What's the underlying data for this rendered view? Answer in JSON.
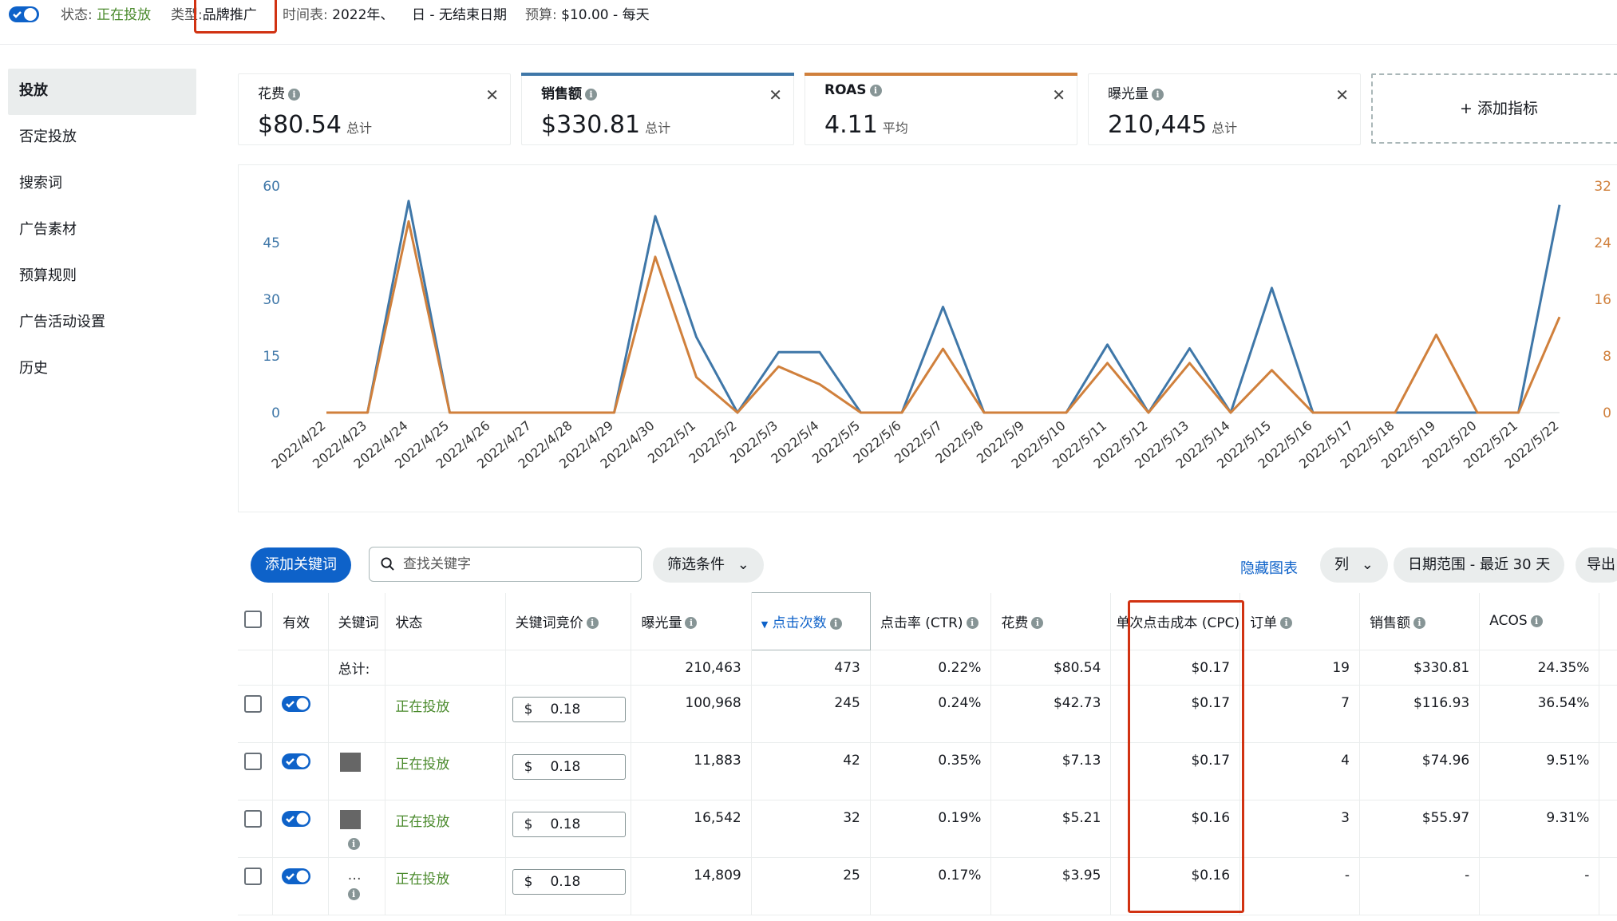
{
  "topbar": {
    "status_label": "状态:",
    "status_value": "正在投放",
    "type_label": "类型:",
    "type_value": "品牌推广",
    "schedule_label": "时间表:",
    "schedule_start": "2022年、",
    "schedule_end": "日 - 无结束日期",
    "budget_label": "预算:",
    "budget_value": "$10.00 - 每天"
  },
  "sidebar": {
    "items": [
      {
        "label": "投放",
        "active": true
      },
      {
        "label": "否定投放"
      },
      {
        "label": "搜索词"
      },
      {
        "label": "广告素材"
      },
      {
        "label": "预算规则"
      },
      {
        "label": "广告活动设置"
      },
      {
        "label": "历史"
      }
    ]
  },
  "metrics": [
    {
      "label": "花费",
      "value": "$80.54",
      "unit": "总计",
      "color": ""
    },
    {
      "label": "销售额",
      "value": "$330.81",
      "unit": "总计",
      "color": "#3f77a8"
    },
    {
      "label": "ROAS",
      "value": "4.11",
      "unit": "平均",
      "color": "#d0803c"
    },
    {
      "label": "曝光量",
      "value": "210,445",
      "unit": "总计",
      "color": ""
    }
  ],
  "add_metric_label": "+ 添加指标",
  "chart_data": {
    "type": "line",
    "x": [
      "2022/4/22",
      "2022/4/23",
      "2022/4/24",
      "2022/4/25",
      "2022/4/26",
      "2022/4/27",
      "2022/4/28",
      "2022/4/29",
      "2022/4/30",
      "2022/5/1",
      "2022/5/2",
      "2022/5/3",
      "2022/5/4",
      "2022/5/5",
      "2022/5/6",
      "2022/5/7",
      "2022/5/8",
      "2022/5/9",
      "2022/5/10",
      "2022/5/11",
      "2022/5/12",
      "2022/5/13",
      "2022/5/14",
      "2022/5/15",
      "2022/5/16",
      "2022/5/17",
      "2022/5/18",
      "2022/5/19",
      "2022/5/20",
      "2022/5/21",
      "2022/5/22"
    ],
    "y_left_ticks": [
      "0",
      "15",
      "30",
      "45",
      "60"
    ],
    "y_right_ticks": [
      "0",
      "8",
      "16",
      "24",
      "32"
    ],
    "ylim_left": [
      0,
      60
    ],
    "ylim_right": [
      0,
      32
    ],
    "series": [
      {
        "color": "#3f77a8",
        "axis": "left",
        "values": [
          0,
          0,
          56,
          0,
          0,
          0,
          0,
          0,
          52,
          20,
          0,
          16,
          16,
          0,
          0,
          28,
          0,
          0,
          0,
          18,
          0,
          17,
          0,
          33,
          0,
          0,
          0,
          0,
          0,
          0,
          55
        ]
      },
      {
        "color": "#d0803c",
        "axis": "right",
        "values": [
          0,
          0,
          27,
          0,
          0,
          0,
          0,
          0,
          22,
          5,
          0,
          6.5,
          4,
          0,
          0,
          9,
          0,
          0,
          0,
          7,
          0,
          7,
          0,
          6,
          0,
          0,
          0,
          11,
          0,
          0,
          13.5
        ]
      }
    ]
  },
  "toolbar": {
    "add_keyword": "添加关键词",
    "search_placeholder": "查找关键字",
    "filter": "筛选条件",
    "hide_chart": "隐藏图表",
    "columns": "列",
    "date_range": "日期范围 - 最近 30 天",
    "export": "导出"
  },
  "table": {
    "headers": {
      "active": "有效",
      "keyword": "关键词",
      "status": "状态",
      "bid": "关键词竞价",
      "impressions": "曝光量",
      "clicks": "点击次数",
      "ctr": "点击率 (CTR)",
      "spend": "花费",
      "cpc": "单次点击成本 (CPC)",
      "orders": "订单",
      "sales": "销售额",
      "acos": "ACOS"
    },
    "total": {
      "label": "总计:",
      "impressions": "210,463",
      "clicks": "473",
      "ctr": "0.22%",
      "spend": "$80.54",
      "cpc": "$0.17",
      "orders": "19",
      "sales": "$330.81",
      "acos": "24.35%"
    },
    "rows": [
      {
        "status": "正在投放",
        "currency": "$",
        "bid": "0.18",
        "impressions": "100,968",
        "clicks": "245",
        "ctr": "0.24%",
        "spend": "$42.73",
        "cpc": "$0.17",
        "orders": "7",
        "sales": "$116.93",
        "acos": "36.54%"
      },
      {
        "status": "正在投放",
        "currency": "$",
        "bid": "0.18",
        "impressions": "11,883",
        "clicks": "42",
        "ctr": "0.35%",
        "spend": "$7.13",
        "cpc": "$0.17",
        "orders": "4",
        "sales": "$74.96",
        "acos": "9.51%"
      },
      {
        "status": "正在投放",
        "currency": "$",
        "bid": "0.18",
        "impressions": "16,542",
        "clicks": "32",
        "ctr": "0.19%",
        "spend": "$5.21",
        "cpc": "$0.16",
        "orders": "3",
        "sales": "$55.97",
        "acos": "9.31%"
      },
      {
        "status": "正在投放",
        "currency": "$",
        "bid": "0.18",
        "impressions": "14,809",
        "clicks": "25",
        "ctr": "0.17%",
        "spend": "$3.95",
        "cpc": "$0.16",
        "orders": "-",
        "sales": "-",
        "acos": "-"
      }
    ]
  },
  "colors": {
    "accent": "#0e62c9",
    "status_green": "#4a8a2c",
    "highlight_red": "#d13212"
  }
}
